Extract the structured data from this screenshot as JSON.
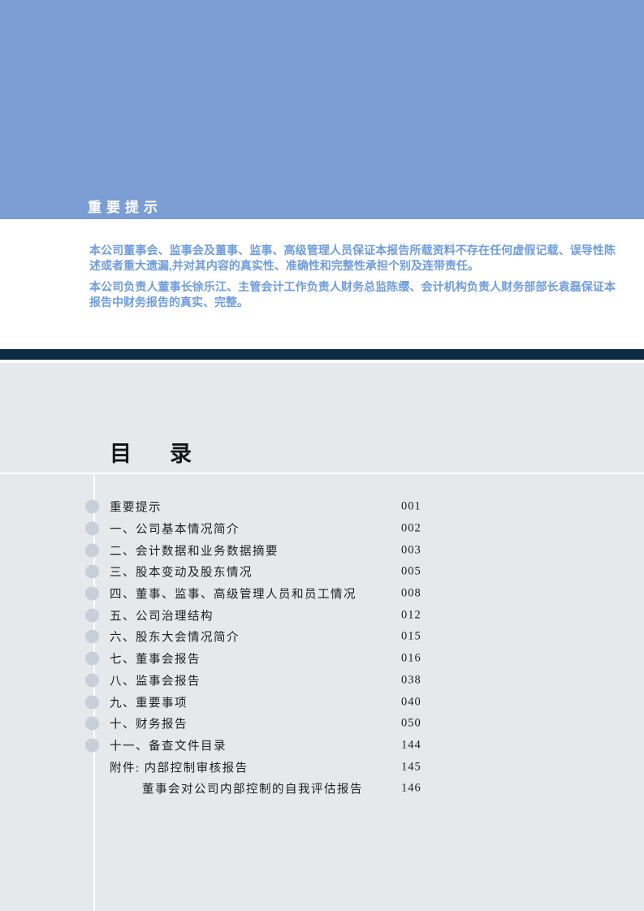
{
  "hero": {
    "title": "重要提示",
    "bg_color": "#7c9dd3",
    "text_color": "#ffffff"
  },
  "notice": {
    "paragraphs": [
      "本公司董事会、监事会及董事、监事、高级管理人员保证本报告所载资料不存在任何虚假记载、误导性陈述或者重大遗漏,并对其内容的真实性、准确性和完整性承担个别及连带责任。",
      "本公司负责人董事长徐乐江、主管会计工作负责人财务总监陈缨、会计机构负责人财务部部长袁磊保证本报告中财务报告的真实、完整。"
    ],
    "text_color": "#6f9cdb"
  },
  "divider": {
    "color": "#0d2b43"
  },
  "toc": {
    "title_left": "目",
    "title_right": "录",
    "bg_color": "#e6e9eb",
    "bullet_color": "#c8cfd9",
    "items": [
      {
        "label": "重要提示",
        "page": "001",
        "bullet": true,
        "indent": 0
      },
      {
        "label": "一、公司基本情况简介",
        "page": "002",
        "bullet": true,
        "indent": 0
      },
      {
        "label": "二、会计数据和业务数据摘要",
        "page": "003",
        "bullet": true,
        "indent": 0
      },
      {
        "label": "三、股本变动及股东情况",
        "page": "005",
        "bullet": true,
        "indent": 0
      },
      {
        "label": "四、董事、监事、高级管理人员和员工情况",
        "page": "008",
        "bullet": true,
        "indent": 0
      },
      {
        "label": "五、公司治理结构",
        "page": "012",
        "bullet": true,
        "indent": 0
      },
      {
        "label": "六、股东大会情况简介",
        "page": "015",
        "bullet": true,
        "indent": 0
      },
      {
        "label": "七、董事会报告",
        "page": "016",
        "bullet": true,
        "indent": 0
      },
      {
        "label": "八、监事会报告",
        "page": "038",
        "bullet": true,
        "indent": 0
      },
      {
        "label": "九、重要事项",
        "page": "040",
        "bullet": true,
        "indent": 0
      },
      {
        "label": "十、财务报告",
        "page": "050",
        "bullet": true,
        "indent": 0
      },
      {
        "label": "十一、备查文件目录",
        "page": "144",
        "bullet": true,
        "indent": 0
      },
      {
        "label": "附件: 内部控制审核报告",
        "page": "145",
        "bullet": false,
        "indent": 0
      },
      {
        "label": "董事会对公司内部控制的自我评估报告",
        "page": "146",
        "bullet": false,
        "indent": 1
      }
    ]
  }
}
